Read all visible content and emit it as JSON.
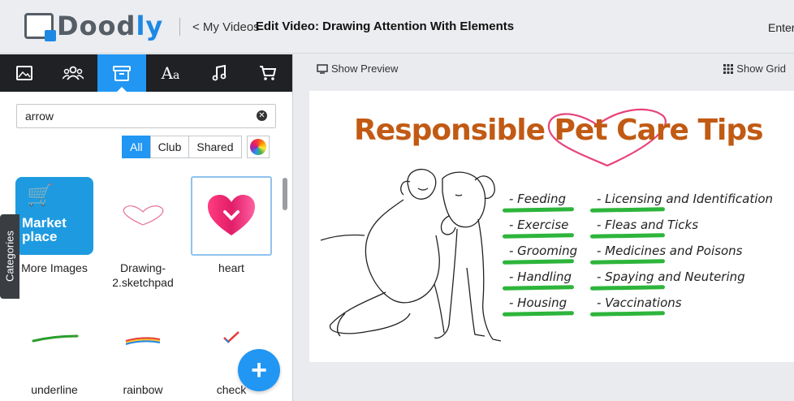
{
  "app": {
    "logo_text_main": "Dood",
    "logo_text_accent": "ly",
    "back_link": "< My Videos",
    "page_title": "Edit Video: Drawing Attention With Elements",
    "enter_label": "Enter"
  },
  "tabs": [
    {
      "icon": "image-icon"
    },
    {
      "icon": "characters-icon"
    },
    {
      "icon": "props-icon",
      "active": true
    },
    {
      "icon": "text-icon"
    },
    {
      "icon": "music-icon"
    },
    {
      "icon": "cart-icon"
    }
  ],
  "search": {
    "value": "arrow"
  },
  "filters": {
    "all": "All",
    "club": "Club",
    "shared": "Shared"
  },
  "categories_label": "Categories",
  "items": [
    {
      "label": "More Images",
      "thumb_text_1": "Market",
      "thumb_text_2": "place"
    },
    {
      "label": "Drawing-\n2.sketchpad"
    },
    {
      "label": "heart"
    },
    {
      "label": "underline"
    },
    {
      "label": "rainbow"
    },
    {
      "label": "check"
    }
  ],
  "right": {
    "show_preview": "Show Preview",
    "show_grid": "Show Grid"
  },
  "canvas": {
    "title": "Responsible Pet Care Tips",
    "title_color": "#c15a14",
    "col1": [
      "- Feeding",
      "- Exercise",
      "- Grooming",
      "- Handling",
      "- Housing"
    ],
    "col2": [
      "- Licensing and Identification",
      "- Fleas and Ticks",
      "- Medicines and Poisons",
      "- Spaying and Neutering",
      "- Vaccinations"
    ]
  }
}
